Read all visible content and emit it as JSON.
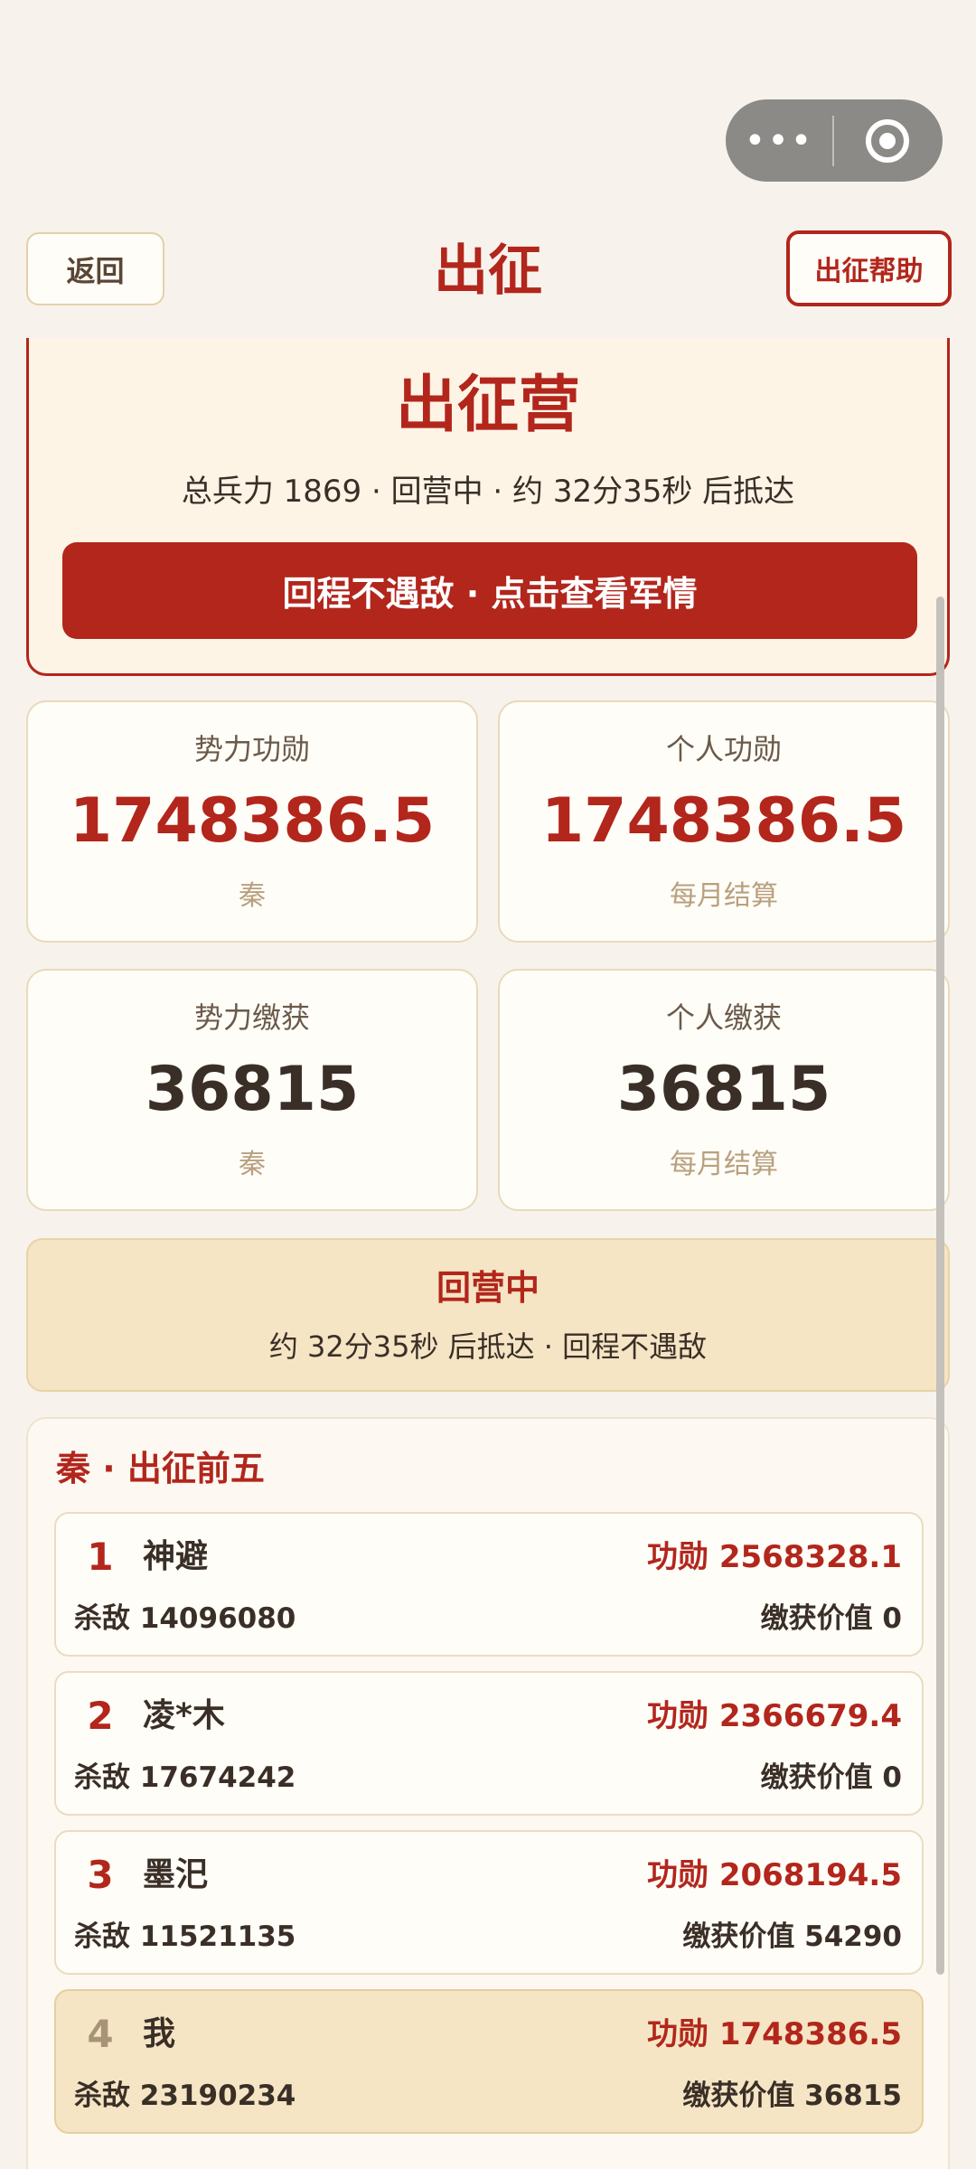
{
  "header": {
    "back_label": "返回",
    "title": "出征",
    "help_label": "出征帮助",
    "capsule_more_icon": "more-dots-icon",
    "capsule_close_icon": "target-ring-icon"
  },
  "camp": {
    "title": "出征营",
    "info": "总兵力 1869 · 回营中 · 约 32分35秒 后抵达",
    "action_label": "回程不遇敌 · 点击查看军情"
  },
  "stats": [
    {
      "label": "势力功勋",
      "value": "1748386.5",
      "sub": "秦"
    },
    {
      "label": "个人功勋",
      "value": "1748386.5",
      "sub": "每月结算"
    },
    {
      "label": "势力缴获",
      "value": "36815",
      "sub": "秦"
    },
    {
      "label": "个人缴获",
      "value": "36815",
      "sub": "每月结算"
    }
  ],
  "status_banner": {
    "title": "回营中",
    "detail": "约 32分35秒 后抵达 · 回程不遇敌"
  },
  "top5": {
    "title": "秦 · 出征前五",
    "rows": [
      {
        "rank": "1",
        "name": "神避",
        "merit": "功勋 2568328.1",
        "kills": "杀敌 14096080",
        "loot": "缴获价值 0"
      },
      {
        "rank": "2",
        "name": "凌*木",
        "merit": "功勋 2366679.4",
        "kills": "杀敌 17674242",
        "loot": "缴获价值 0"
      },
      {
        "rank": "3",
        "name": "墨汜",
        "merit": "功勋 2068194.5",
        "kills": "杀敌 11521135",
        "loot": "缴获价值 54290"
      },
      {
        "rank": "4",
        "name": "我",
        "merit": "功勋 1748386.5",
        "kills": "杀敌 23190234",
        "loot": "缴获价值 36815"
      }
    ]
  },
  "colors": {
    "accent_red": "#b2261c",
    "background": "#f7f3ec",
    "highlight": "#f5e5c5"
  }
}
